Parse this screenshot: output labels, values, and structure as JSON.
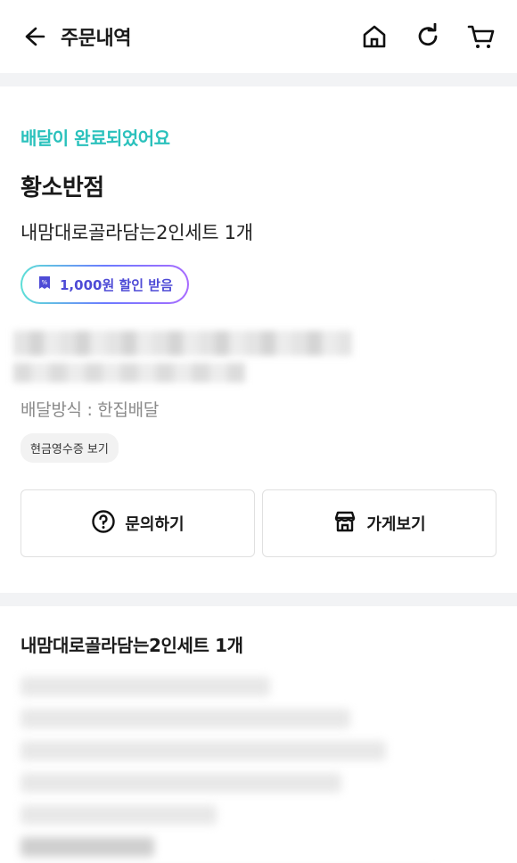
{
  "header": {
    "title": "주문내역",
    "icons": [
      "back-arrow-icon",
      "home-icon",
      "refresh-icon",
      "cart-icon"
    ]
  },
  "order": {
    "status": "배달이 완료되었어요",
    "store_name": "황소반점",
    "item_summary": "내맘대로골라담는2인세트 1개",
    "coupon": "1,000원 할인 받음",
    "delivery_method": "배달방식 : 한집배달",
    "receipt_label": "현금영수증 보기"
  },
  "actions": {
    "inquiry_label": "문의하기",
    "store_label": "가게보기"
  },
  "details": {
    "title": "내맘대로골라담는2인세트 1개"
  },
  "colors": {
    "accent": "#2ac1bc",
    "coupon_text": "#4e4bd6",
    "divider": "#f2f3f5"
  }
}
